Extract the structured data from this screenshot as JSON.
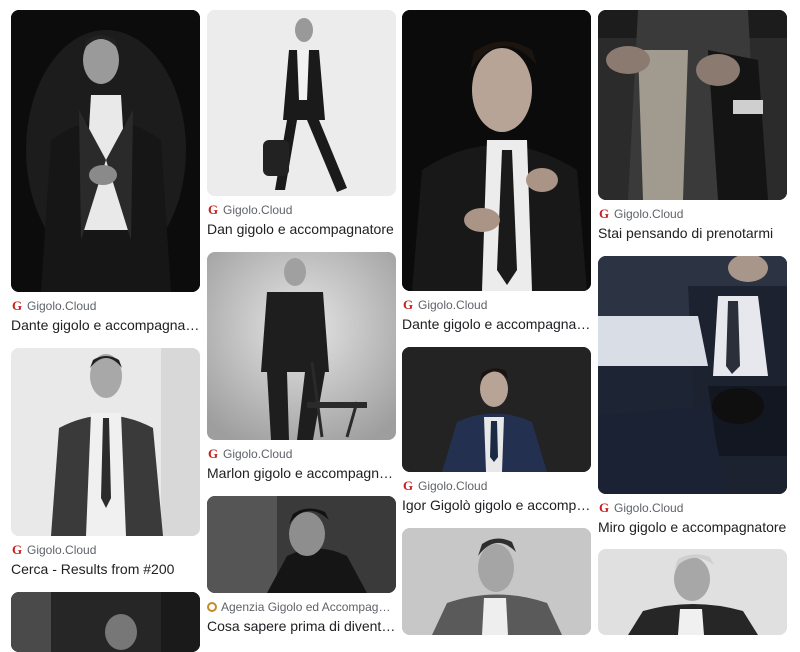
{
  "results": [
    {
      "source": "Gigolo.Cloud",
      "title": "Dante gigolo e accompagnatore",
      "favicon": "gigolo-g-icon"
    },
    {
      "source": "Gigolo.Cloud",
      "title": "Cerca - Results from #200",
      "favicon": "gigolo-g-icon"
    },
    {
      "source": "Gigolo.Cloud",
      "title": "Dan gigolo e accompagnatore",
      "favicon": "gigolo-g-icon"
    },
    {
      "source": "Gigolo.Cloud",
      "title": "Marlon gigolo e accompagnatore",
      "favicon": "gigolo-g-icon"
    },
    {
      "source": "Agenzia Gigolo ed Accompagnatori",
      "title": "Cosa sapere prima di diventare gigolo",
      "favicon": "agency-circle-icon"
    },
    {
      "source": "Gigolo.Cloud",
      "title": "Dante gigolo e accompagnatore",
      "favicon": "gigolo-g-icon"
    },
    {
      "source": "Gigolo.Cloud",
      "title": "Igor Gigolò gigolo e accompagnatore",
      "favicon": "gigolo-g-icon"
    },
    {
      "source": "Gigolo.Cloud",
      "title": "Stai pensando di prenotarmi",
      "favicon": "gigolo-g-icon"
    },
    {
      "source": "Gigolo.Cloud",
      "title": "Miro gigolo e accompagnatore",
      "favicon": "gigolo-g-icon"
    }
  ],
  "colors": {
    "favicon_red": "#c5221f",
    "agency_gold": "#c58b2a",
    "meta_text": "#5f6368"
  }
}
